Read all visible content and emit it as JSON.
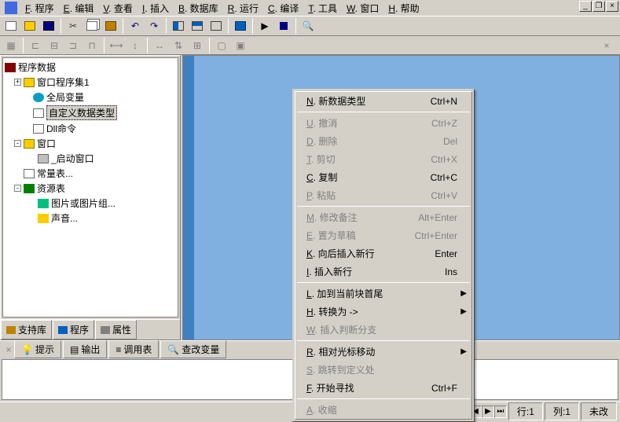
{
  "menubar": {
    "items": [
      {
        "u": "F",
        "label": ". 程序"
      },
      {
        "u": "E",
        "label": ". 编辑"
      },
      {
        "u": "V",
        "label": ". 查看"
      },
      {
        "u": "I",
        "label": ". 插入"
      },
      {
        "u": "B",
        "label": ". 数据库"
      },
      {
        "u": "R",
        "label": ". 运行"
      },
      {
        "u": "C",
        "label": ". 编译"
      },
      {
        "u": "T",
        "label": ". 工具"
      },
      {
        "u": "W",
        "label": ". 窗口"
      },
      {
        "u": "H",
        "label": ". 帮助"
      }
    ]
  },
  "tree": {
    "root": "程序数据",
    "items": [
      {
        "label": "窗口程序集1",
        "indent": 12,
        "exp": "+",
        "icon": "ic-folder"
      },
      {
        "label": "全局变量",
        "indent": 24,
        "exp": "",
        "icon": "ic-globe"
      },
      {
        "label": "自定义数据类型",
        "indent": 24,
        "exp": "",
        "icon": "ic-page",
        "selected": true
      },
      {
        "label": "Dll命令",
        "indent": 24,
        "exp": "",
        "icon": "ic-page"
      },
      {
        "label": "窗口",
        "indent": 12,
        "exp": "-",
        "icon": "ic-folder"
      },
      {
        "label": "_启动窗口",
        "indent": 30,
        "exp": "",
        "icon": "ic-form"
      },
      {
        "label": "常量表...",
        "indent": 12,
        "exp": "",
        "icon": "ic-page"
      },
      {
        "label": "资源表",
        "indent": 12,
        "exp": "-",
        "icon": "ic-res"
      },
      {
        "label": "图片或图片组...",
        "indent": 30,
        "exp": "",
        "icon": "ic-img"
      },
      {
        "label": "声音...",
        "indent": 30,
        "exp": "",
        "icon": "ic-snd"
      }
    ]
  },
  "side_tabs": [
    {
      "label": "支持库"
    },
    {
      "label": "程序"
    },
    {
      "label": "属性"
    }
  ],
  "context_menu": [
    {
      "u": "N",
      "label": ". 新数据类型",
      "shortcut": "Ctrl+N",
      "enabled": true
    },
    {
      "sep": true
    },
    {
      "u": "U",
      "label": ". 撤消",
      "shortcut": "Ctrl+Z",
      "enabled": false
    },
    {
      "u": "D",
      "label": ". 删除",
      "shortcut": "Del",
      "enabled": false
    },
    {
      "u": "T",
      "label": ". 剪切",
      "shortcut": "Ctrl+X",
      "enabled": false
    },
    {
      "u": "C",
      "label": ". 复制",
      "shortcut": "Ctrl+C",
      "enabled": true
    },
    {
      "u": "P",
      "label": ". 粘贴",
      "shortcut": "Ctrl+V",
      "enabled": false
    },
    {
      "sep": true
    },
    {
      "u": "M",
      "label": ". 修改备注",
      "shortcut": "Alt+Enter",
      "enabled": false
    },
    {
      "u": "E",
      "label": ". 置为草稿",
      "shortcut": "Ctrl+Enter",
      "enabled": false
    },
    {
      "u": "K",
      "label": ". 向后插入新行",
      "shortcut": "Enter",
      "enabled": true
    },
    {
      "u": "I",
      "label": ". 插入新行",
      "shortcut": "Ins",
      "enabled": true
    },
    {
      "sep": true
    },
    {
      "u": "L",
      "label": ". 加到当前块首尾",
      "shortcut": "",
      "enabled": true,
      "sub": true
    },
    {
      "u": "H",
      "label": ". 转换为 ->",
      "shortcut": "",
      "enabled": true,
      "sub": true
    },
    {
      "u": "W",
      "label": ". 插入判断分支",
      "shortcut": "",
      "enabled": false
    },
    {
      "sep": true
    },
    {
      "u": "R",
      "label": ". 相对光标移动",
      "shortcut": "",
      "enabled": true,
      "sub": true
    },
    {
      "u": "S",
      "label": ". 跳转到定义处",
      "shortcut": "",
      "enabled": false
    },
    {
      "u": "F",
      "label": ". 开始寻找",
      "shortcut": "Ctrl+F",
      "enabled": true
    },
    {
      "sep": true
    },
    {
      "u": "A",
      "label": ". 收缩",
      "shortcut": "",
      "enabled": false
    }
  ],
  "bottom_tabs": [
    {
      "label": "提示"
    },
    {
      "label": "输出"
    },
    {
      "label": "调用表"
    },
    {
      "label": "查改变量"
    }
  ],
  "status": {
    "row_label": "行:",
    "row": "1",
    "col_label": "列:",
    "col": "1",
    "modified": "未改"
  }
}
